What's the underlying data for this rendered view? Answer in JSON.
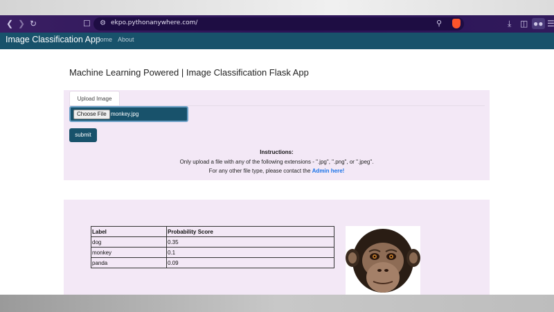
{
  "browser": {
    "url": "ekpo.pythonanywhere.com/"
  },
  "navbar": {
    "brand": "Image Classification App",
    "links": [
      "Home",
      "About"
    ]
  },
  "page": {
    "title": "Machine Learning Powered | Image Classification Flask App",
    "upload_tab": "Upload Image",
    "choose_file_label": "Choose File",
    "file_name": "monkey.jpg",
    "submit_label": "submit",
    "instructions_title": "Instructions:",
    "instructions_line1": "Only upload a file with any of the following extensions - \".jpg\", \".png\", or \".jpeg\".",
    "instructions_line2": "For any other file type, please contact the",
    "admin_link": "Admin here!"
  },
  "results": {
    "headers": [
      "Label",
      "Probability Score"
    ],
    "rows": [
      [
        "dog",
        "0.35"
      ],
      [
        "monkey",
        "0.1"
      ],
      [
        "panda",
        "0.09"
      ]
    ]
  },
  "colors": {
    "navbar": "#18526b",
    "panel": "#f3e8f6",
    "browser_bar": "#2a1255",
    "link": "#1a73e8"
  }
}
